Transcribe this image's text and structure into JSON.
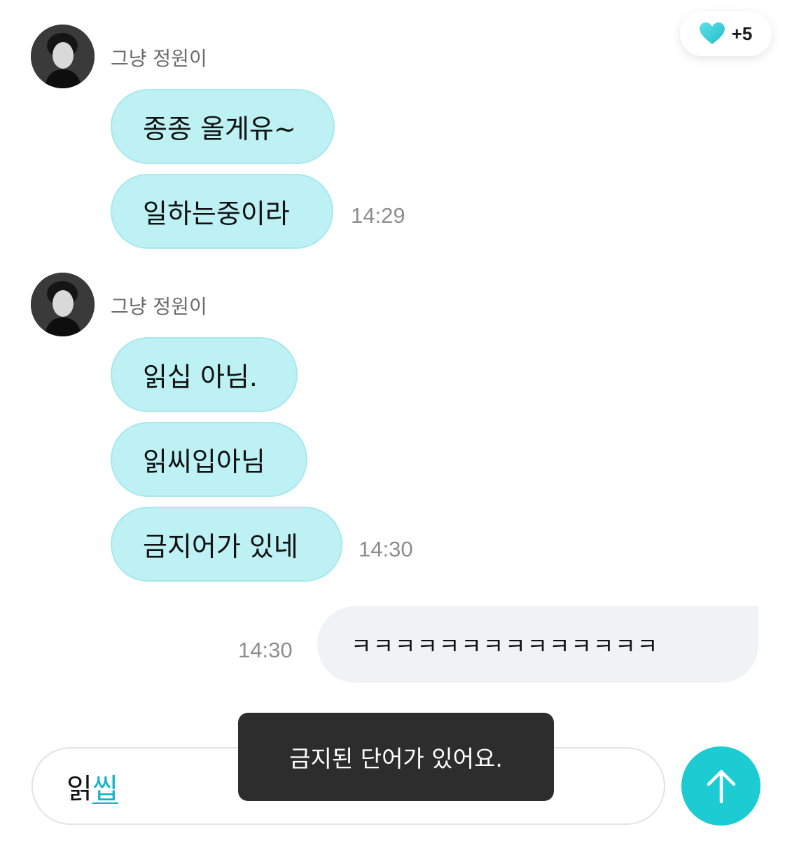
{
  "header": {
    "heart_count": "+5",
    "heart_icon": "heart-icon",
    "heart_color": "#3cc9d6"
  },
  "messages": {
    "group1": {
      "sender": "그냥 정원이",
      "bubbles": [
        "종종 올게유~",
        "일하는중이라"
      ],
      "time": "14:29"
    },
    "group2": {
      "sender": "그냥 정원이",
      "bubbles": [
        "읽십 아님.",
        "읽씨입아님",
        "금지어가 있네"
      ],
      "time": "14:30"
    },
    "outgoing": {
      "text": "ㅋㅋㅋㅋㅋㅋㅋㅋㅋㅋㅋㅋㅋㅋ",
      "time": "14:30"
    }
  },
  "composer": {
    "typed_text": "읽",
    "composing_text": "씹",
    "send_icon": "arrow-up-icon"
  },
  "toast": {
    "text": "금지된 단어가 있어요."
  },
  "colors": {
    "incoming_bubble": "#bdf1f4",
    "outgoing_bubble": "#f1f2f6",
    "accent": "#1dcbd3",
    "toast_bg": "#2d2d2d"
  }
}
